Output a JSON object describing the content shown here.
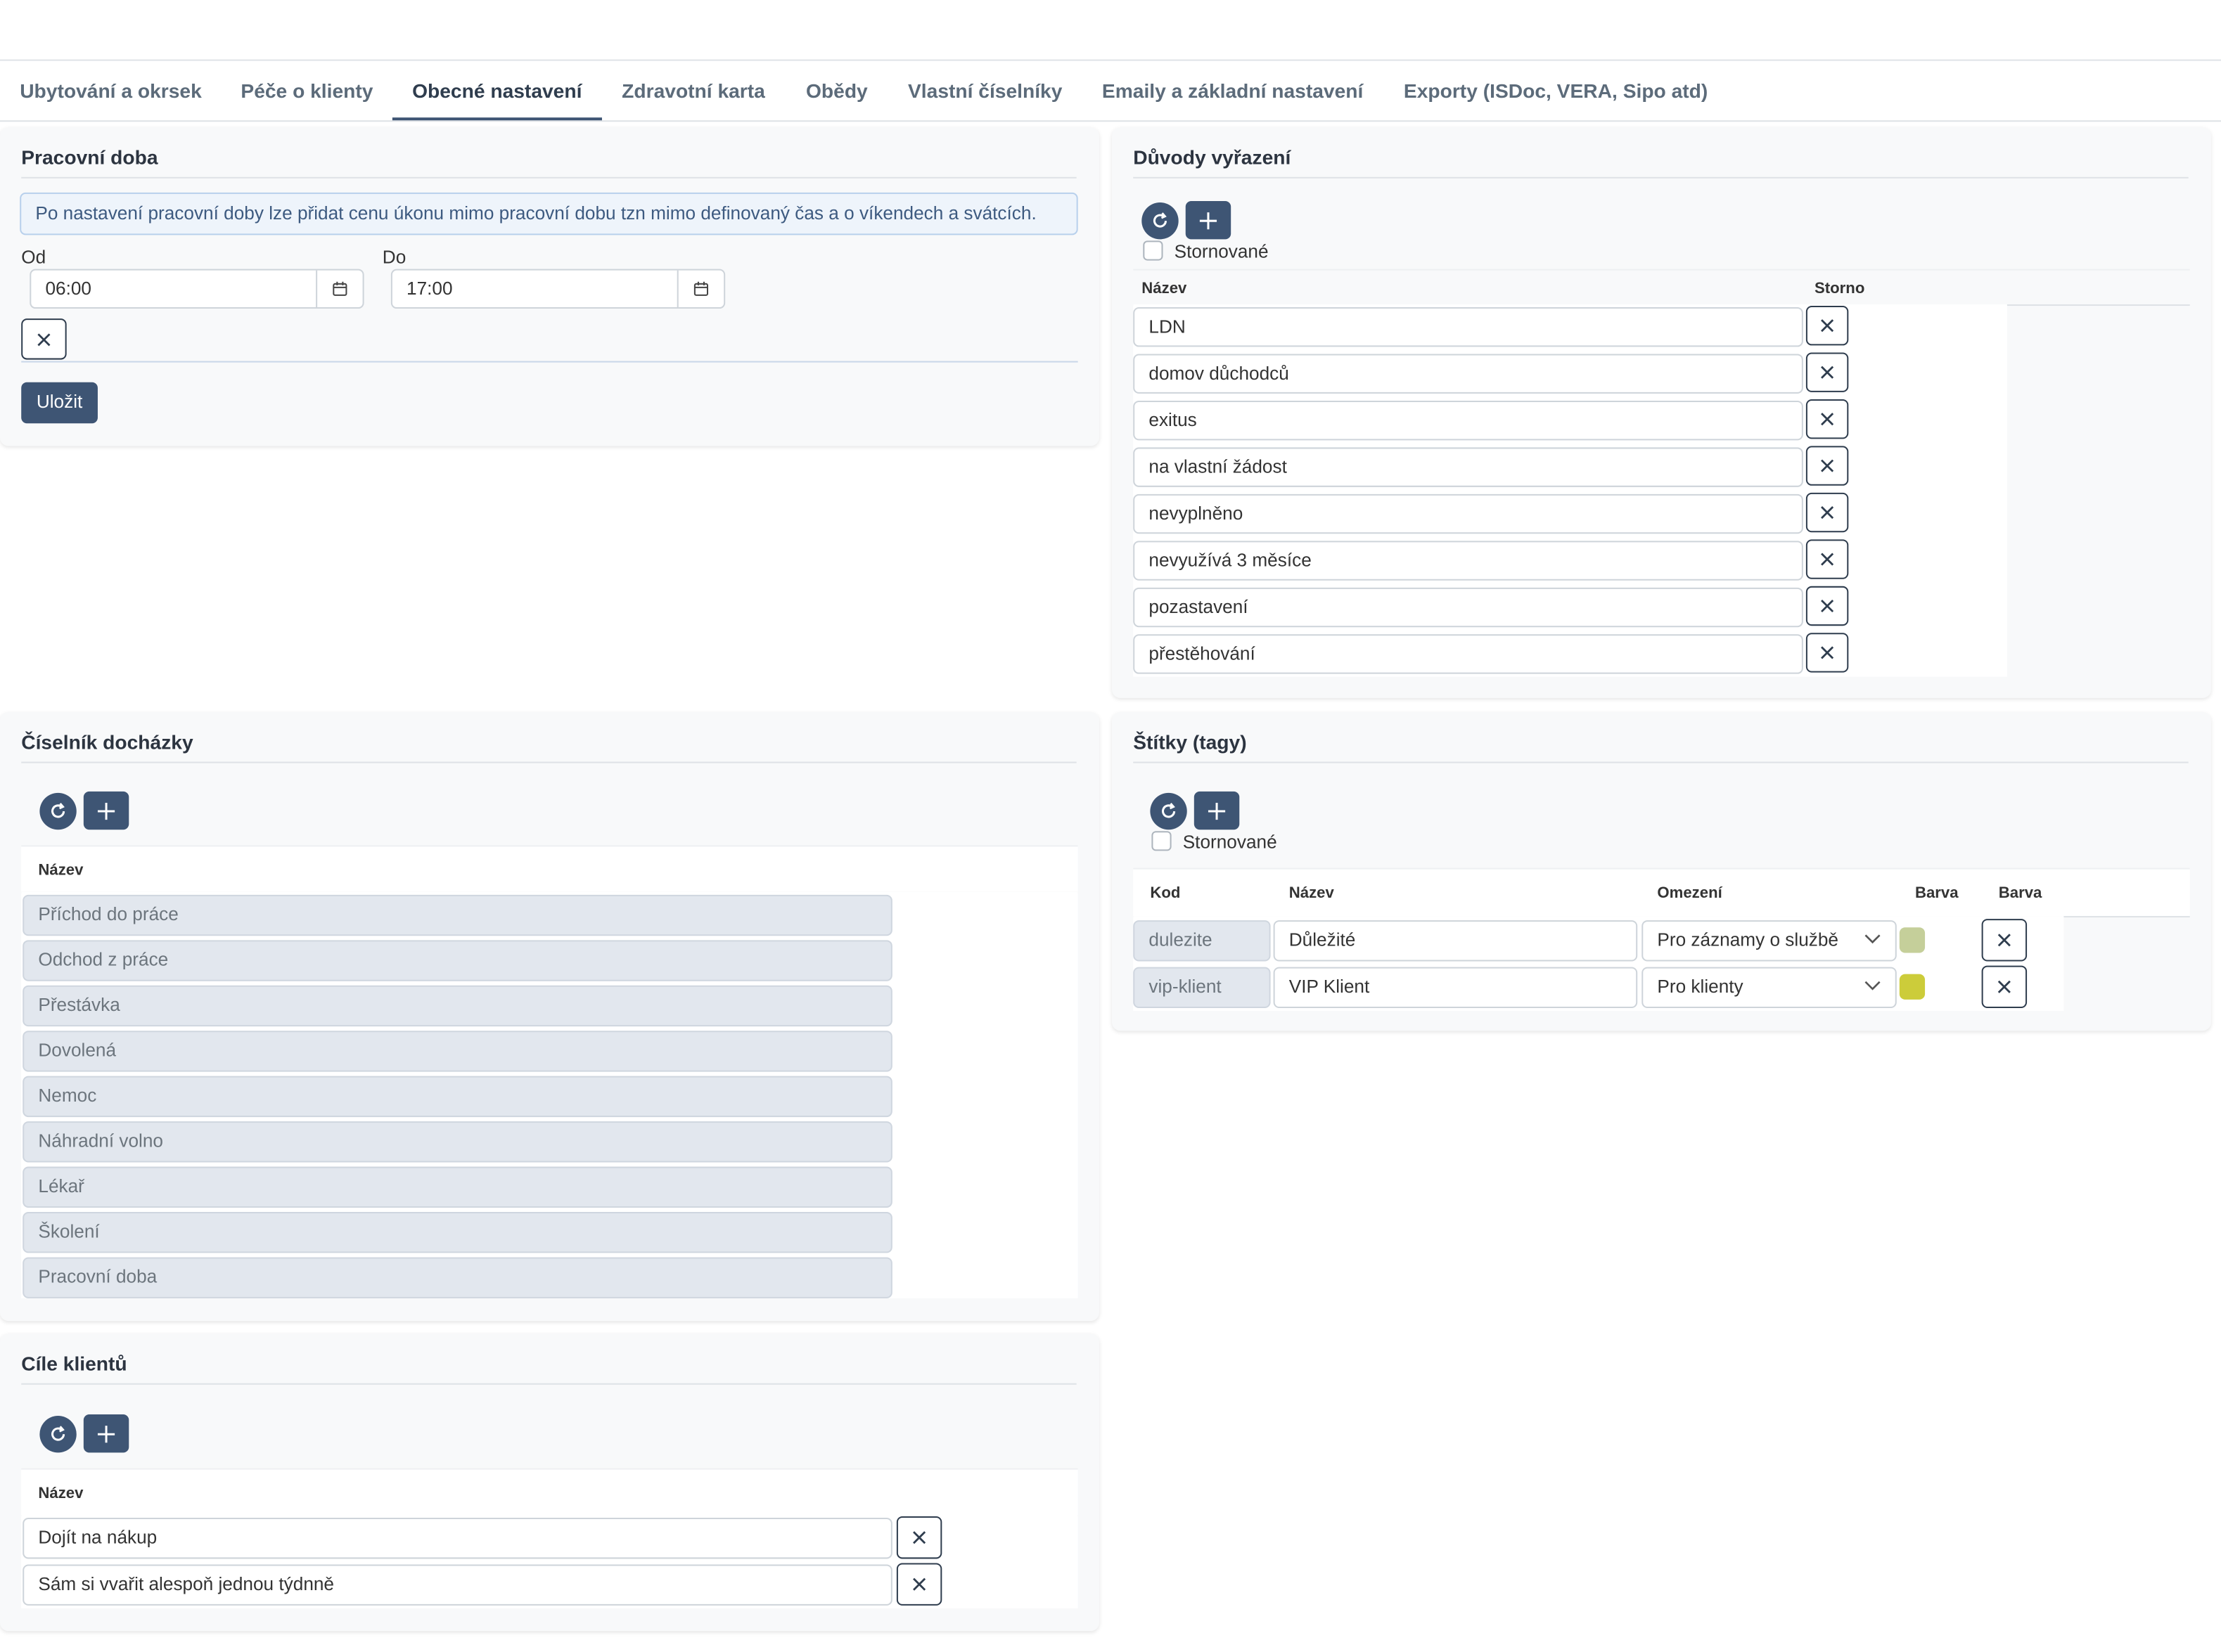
{
  "tabs": [
    "Ubytování a okrsek",
    "Péče o klienty",
    "Obecné nastavení",
    "Zdravotní karta",
    "Obědy",
    "Vlastní číselníky",
    "Emaily a základní nastavení",
    "Exporty (ISDoc, VERA, Sipo atd)"
  ],
  "active_tab": "Obecné nastavení",
  "pracovni_doba": {
    "title": "Pracovní doba",
    "info": "Po nastavení pracovní doby lze přidat cenu úkonu mimo pracovní dobu tzn mimo definovaný čas a o víkendech a svátcích.",
    "od_label": "Od",
    "od_value": "06:00",
    "do_label": "Do",
    "do_value": "17:00",
    "save_label": "Uložit"
  },
  "duvody": {
    "title": "Důvody vyřazení",
    "checkbox_label": "Stornované",
    "col_nazev": "Název",
    "col_storno": "Storno",
    "rows": [
      "LDN",
      "domov důchodců",
      "exitus",
      "na vlastní žádost",
      "nevyplněno",
      "nevyužívá 3 měsíce",
      "pozastavení",
      "přestěhování"
    ]
  },
  "dochazka": {
    "title": "Číselník docházky",
    "col_nazev": "Název",
    "rows": [
      "Příchod do práce",
      "Odchod z práce",
      "Přestávka",
      "Dovolená",
      "Nemoc",
      "Náhradní volno",
      "Lékař",
      "Školení",
      "Pracovní doba"
    ]
  },
  "stitky": {
    "title": "Štítky (tagy)",
    "checkbox_label": "Stornované",
    "col_kod": "Kod",
    "col_nazev": "Název",
    "col_omezeni": "Omezení",
    "col_barva1": "Barva",
    "col_barva2": "Barva",
    "rows": [
      {
        "kod": "dulezite",
        "nazev": "Důležité",
        "omezeni": "Pro záznamy o službě",
        "color": "#c5cf9a"
      },
      {
        "kod": "vip-klient",
        "nazev": "VIP Klient",
        "omezeni": "Pro klienty",
        "color": "#cccc3a"
      }
    ]
  },
  "cile": {
    "title": "Cíle klientů",
    "col_nazev": "Název",
    "rows": [
      "Dojít na nákup",
      "Sám si vvařit alespoň jednou týdnně"
    ]
  },
  "colors": {
    "primary": "#3e5574"
  },
  "icons": {
    "refresh": "refresh-icon",
    "plus": "plus-icon",
    "close": "close-icon",
    "calendar": "calendar-icon",
    "chevron": "chevron-down-icon"
  }
}
